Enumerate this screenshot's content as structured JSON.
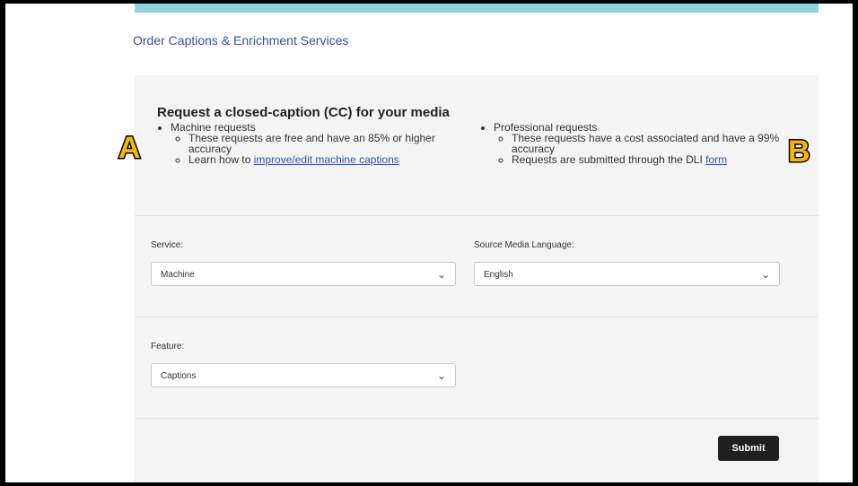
{
  "header": {
    "link_text": "Order Captions & Enrichment Services"
  },
  "intro": {
    "heading": "Request a closed-caption (CC) for your media",
    "left": {
      "title": "Machine requests",
      "line1": "These requests are free and have an 85% or higher accuracy",
      "line2_prefix": "Learn how to ",
      "line2_link": "improve/edit machine captions"
    },
    "right": {
      "title": "Professional requests",
      "line1": "These requests have a cost associated and have a 99% accuracy",
      "line2_prefix": "Requests are submitted through the DLI ",
      "line2_link": "form"
    },
    "markers": {
      "a": "A",
      "b": "B"
    }
  },
  "form": {
    "service": {
      "label": "Service:",
      "value": "Machine"
    },
    "language": {
      "label": "Source Media Language:",
      "value": "English"
    },
    "feature": {
      "label": "Feature:",
      "value": "Captions"
    },
    "submit_label": "Submit"
  },
  "colors": {
    "accent": "#8fd3e0",
    "link": "#3b4f9e",
    "marker": "#f7b50d"
  },
  "icons": {
    "dropdown": "chevron-down-icon"
  }
}
